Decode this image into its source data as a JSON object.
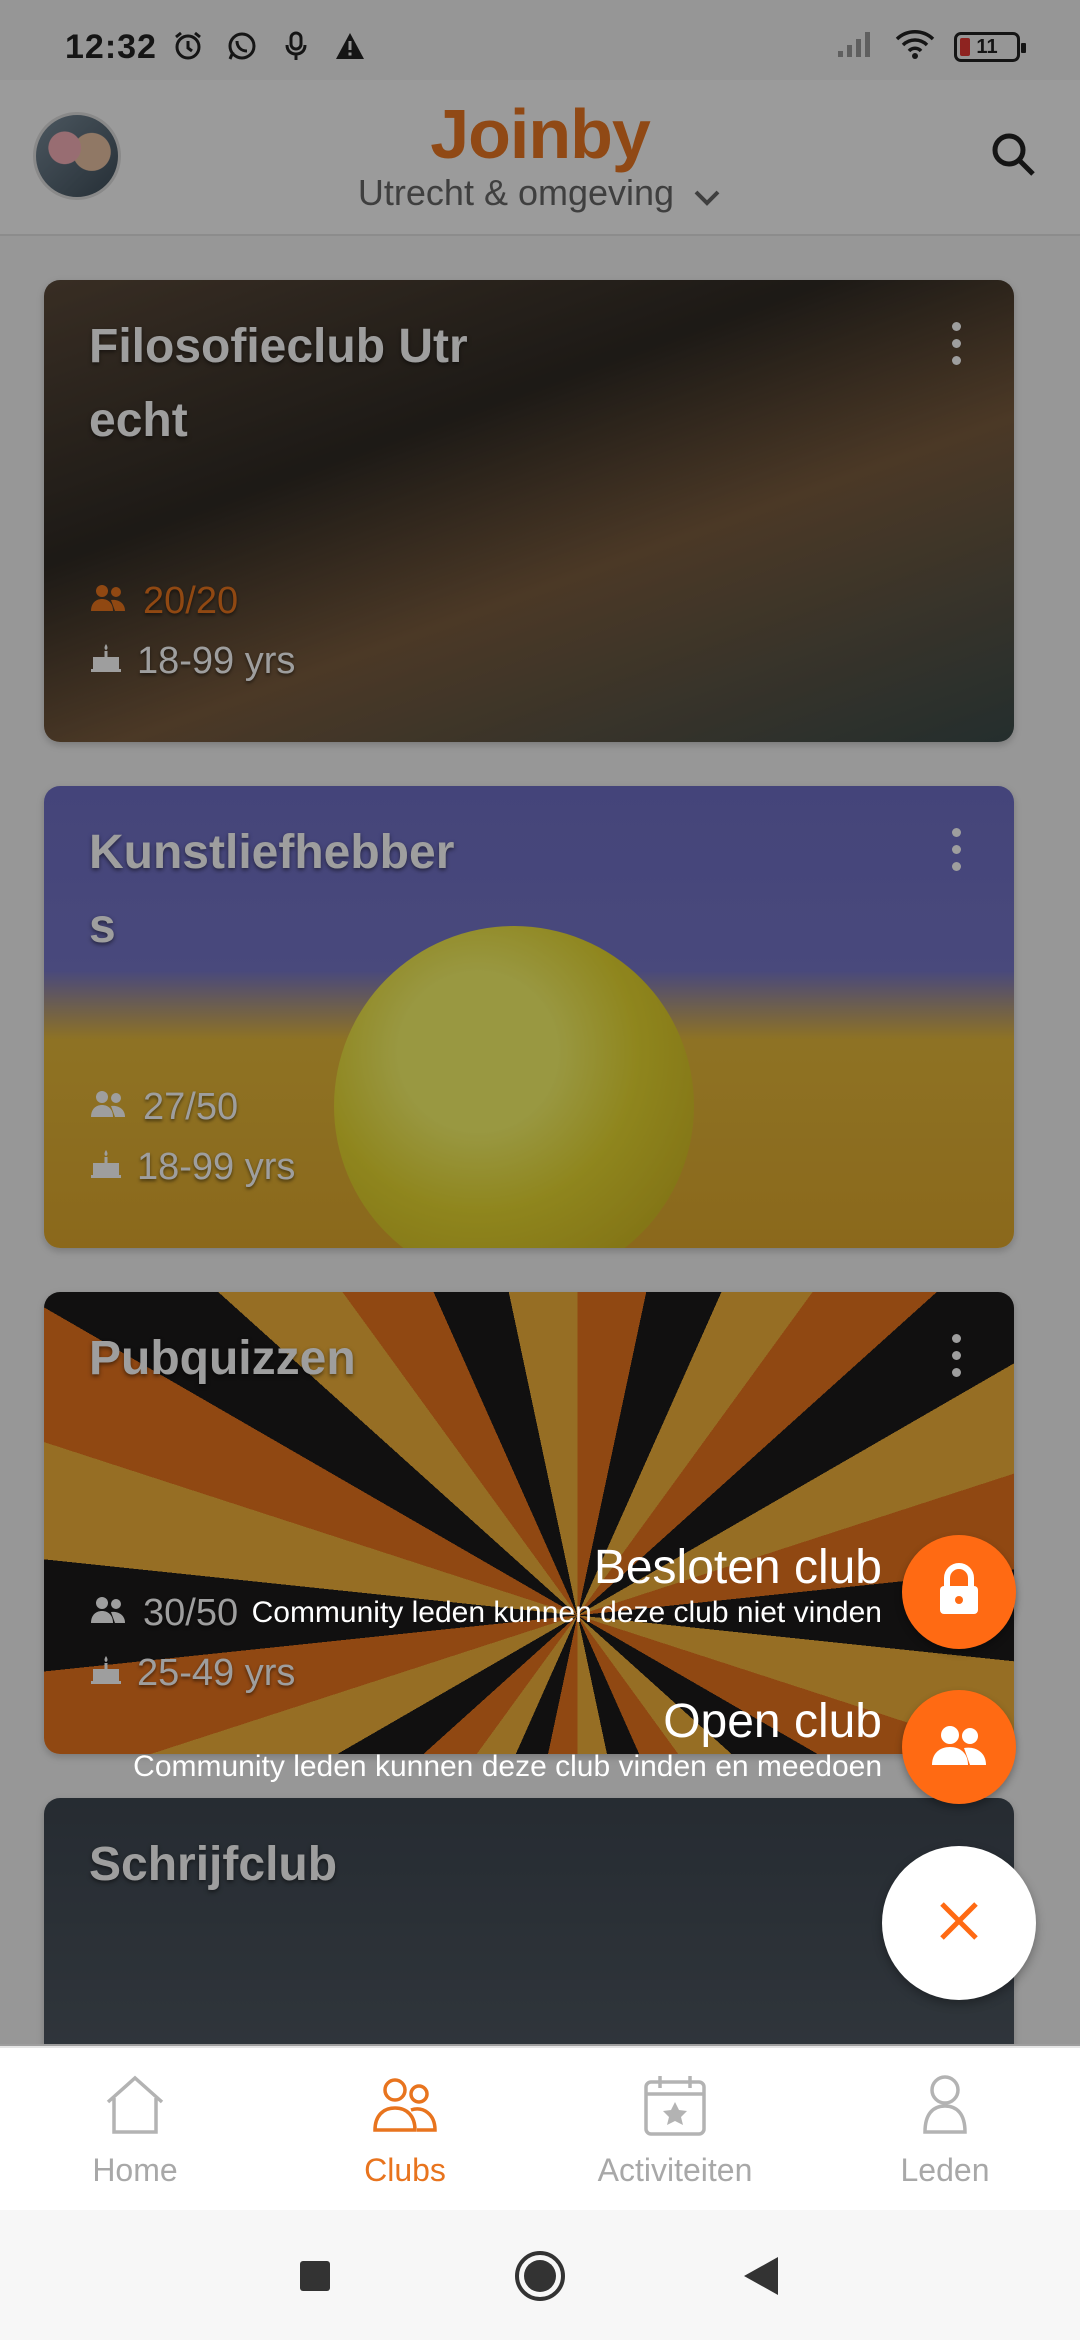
{
  "status_bar": {
    "time": "12:32",
    "battery": "11"
  },
  "header": {
    "app_name": "Joinby",
    "region": "Utrecht & omgeving"
  },
  "clubs": [
    {
      "title": "Filosofieclub Utrecht",
      "members": "20/20",
      "ages": "18-99 yrs"
    },
    {
      "title": "Kunstliefhebbers",
      "members": "27/50",
      "ages": "18-99 yrs"
    },
    {
      "title": "Pubquizzen",
      "members": "30/50",
      "ages": "25-49 yrs"
    },
    {
      "title": "Schrijfclub"
    }
  ],
  "speed_dial": {
    "closed": {
      "label": "Besloten club",
      "desc": "Community leden kunnen deze club niet vinden"
    },
    "open": {
      "label": "Open club",
      "desc": "Community leden kunnen deze club vinden en meedoen"
    }
  },
  "nav": {
    "home": "Home",
    "clubs": "Clubs",
    "activities": "Activiteiten",
    "members": "Leden"
  },
  "colors": {
    "accent": "#e8741e",
    "fab": "#ff6a13",
    "full_capacity": "#e8741e"
  },
  "icons": [
    "alarm-icon",
    "whatsapp-icon",
    "mic-icon",
    "warning-icon",
    "signal-icon",
    "wifi-icon",
    "battery-icon",
    "search-icon",
    "chevron-down-icon",
    "more-vert-icon",
    "people-icon",
    "cake-icon",
    "lock-icon",
    "close-icon",
    "home-icon",
    "clubs-icon",
    "calendar-icon",
    "person-icon"
  ]
}
